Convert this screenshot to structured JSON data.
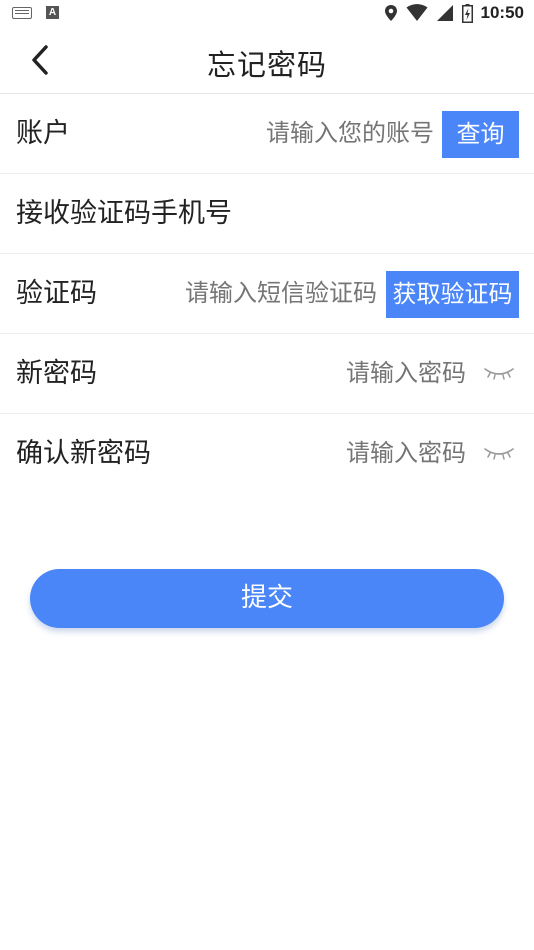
{
  "status_bar": {
    "time": "10:50",
    "left_icons": [
      "keyboard-icon",
      "a-letter-icon"
    ],
    "right_icons": [
      "location-icon",
      "wifi-icon",
      "signal-icon",
      "battery-icon"
    ]
  },
  "app_bar": {
    "title": "忘记密码",
    "back_icon": "chevron-left-icon"
  },
  "form": {
    "account": {
      "label": "账户",
      "placeholder": "请输入您的账号",
      "button": "查询"
    },
    "phone": {
      "label": "接收验证码手机号"
    },
    "code": {
      "label": "验证码",
      "placeholder": "请输入短信验证码",
      "button": "获取验证码"
    },
    "new_password": {
      "label": "新密码",
      "placeholder": "请输入密码",
      "toggle_icon": "eye-closed-icon"
    },
    "confirm_password": {
      "label": "确认新密码",
      "placeholder": "请输入密码",
      "toggle_icon": "eye-closed-icon"
    }
  },
  "submit_label": "提交",
  "colors": {
    "accent": "#4a86f7",
    "text": "#222222",
    "placeholder": "#7d7d7d",
    "divider": "#ececec"
  }
}
